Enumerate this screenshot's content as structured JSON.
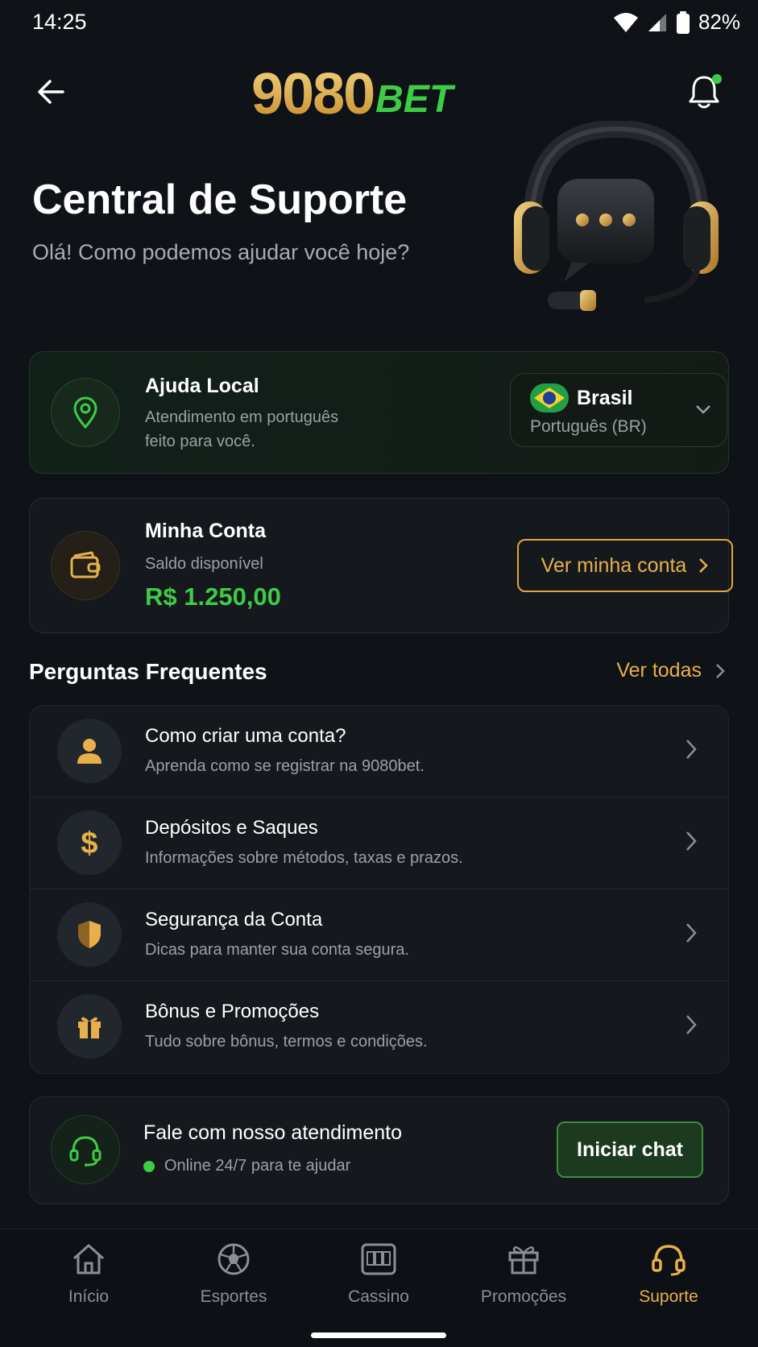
{
  "status_bar": {
    "time": "14:25",
    "battery": "82%"
  },
  "header": {
    "logo_num": "9080",
    "logo_bet": "BET"
  },
  "hero": {
    "title": "Central de Suporte",
    "subtitle": "Olá! Como podemos ajudar você hoje?"
  },
  "local_help": {
    "title": "Ajuda Local",
    "desc_line1": "Atendimento em português",
    "desc_line2": "feito para você.",
    "country": "Brasil",
    "language": "Português (BR)"
  },
  "account": {
    "title": "Minha Conta",
    "balance_label": "Saldo disponível",
    "balance": "R$ 1.250,00",
    "button": "Ver minha conta"
  },
  "faq": {
    "title": "Perguntas Frequentes",
    "see_all": "Ver todas",
    "items": [
      {
        "title": "Como criar uma conta?",
        "desc": "Aprenda como se registrar na 9080bet.",
        "icon": "user-icon"
      },
      {
        "title": "Depósitos e Saques",
        "desc": "Informações sobre métodos, taxas e prazos.",
        "icon": "dollar-icon"
      },
      {
        "title": "Segurança da Conta",
        "desc": "Dicas para manter sua conta segura.",
        "icon": "shield-icon"
      },
      {
        "title": "Bônus e Promoções",
        "desc": "Tudo sobre bônus, termos e condições.",
        "icon": "gift-icon"
      }
    ]
  },
  "support": {
    "title": "Fale com nosso atendimento",
    "status": "Online 24/7 para te ajudar",
    "button": "Iniciar chat"
  },
  "nav": {
    "items": [
      {
        "label": "Início",
        "icon": "home-icon"
      },
      {
        "label": "Esportes",
        "icon": "soccer-ball-icon"
      },
      {
        "label": "Cassino",
        "icon": "slot-machine-icon"
      },
      {
        "label": "Promoções",
        "icon": "gift-icon"
      },
      {
        "label": "Suporte",
        "icon": "headset-icon"
      }
    ],
    "active": "Suporte"
  },
  "colors": {
    "gold": "#e7b04a",
    "green": "#3ecb45",
    "background": "#0f1216"
  }
}
